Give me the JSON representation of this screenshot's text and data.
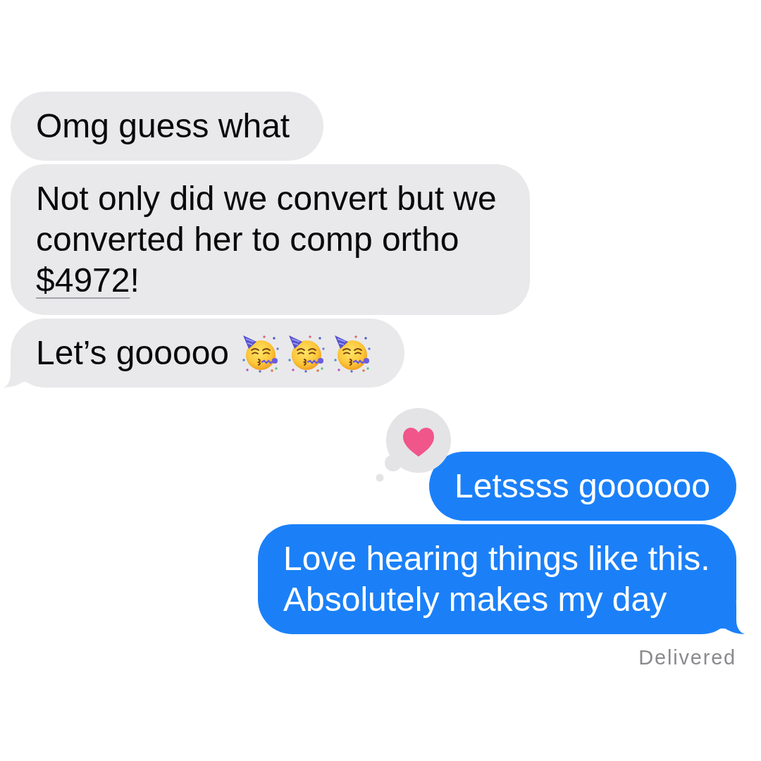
{
  "messages": [
    {
      "kind": "received",
      "tail": false,
      "segments": [
        {
          "kind": "text",
          "text": "Omg guess what"
        }
      ]
    },
    {
      "kind": "received",
      "tail": false,
      "segments": [
        {
          "kind": "text",
          "text": "Not only did we convert but we converted her to comp ortho "
        },
        {
          "kind": "link",
          "text": "$4972"
        },
        {
          "kind": "text",
          "text": "!"
        }
      ]
    },
    {
      "kind": "received",
      "tail": true,
      "segments": [
        {
          "kind": "text",
          "text": "Let’s gooooo"
        },
        {
          "kind": "party-face"
        },
        {
          "kind": "party-face"
        },
        {
          "kind": "party-face"
        }
      ]
    },
    {
      "kind": "sent",
      "tail": false,
      "reaction": {
        "kind": "heart"
      },
      "segments": [
        {
          "kind": "text",
          "text": "Letssss goooooo"
        }
      ]
    },
    {
      "kind": "sent",
      "tail": true,
      "segments": [
        {
          "kind": "text",
          "text": "Love hearing things like this. Absolutely makes my day"
        }
      ]
    }
  ],
  "status": "Delivered"
}
